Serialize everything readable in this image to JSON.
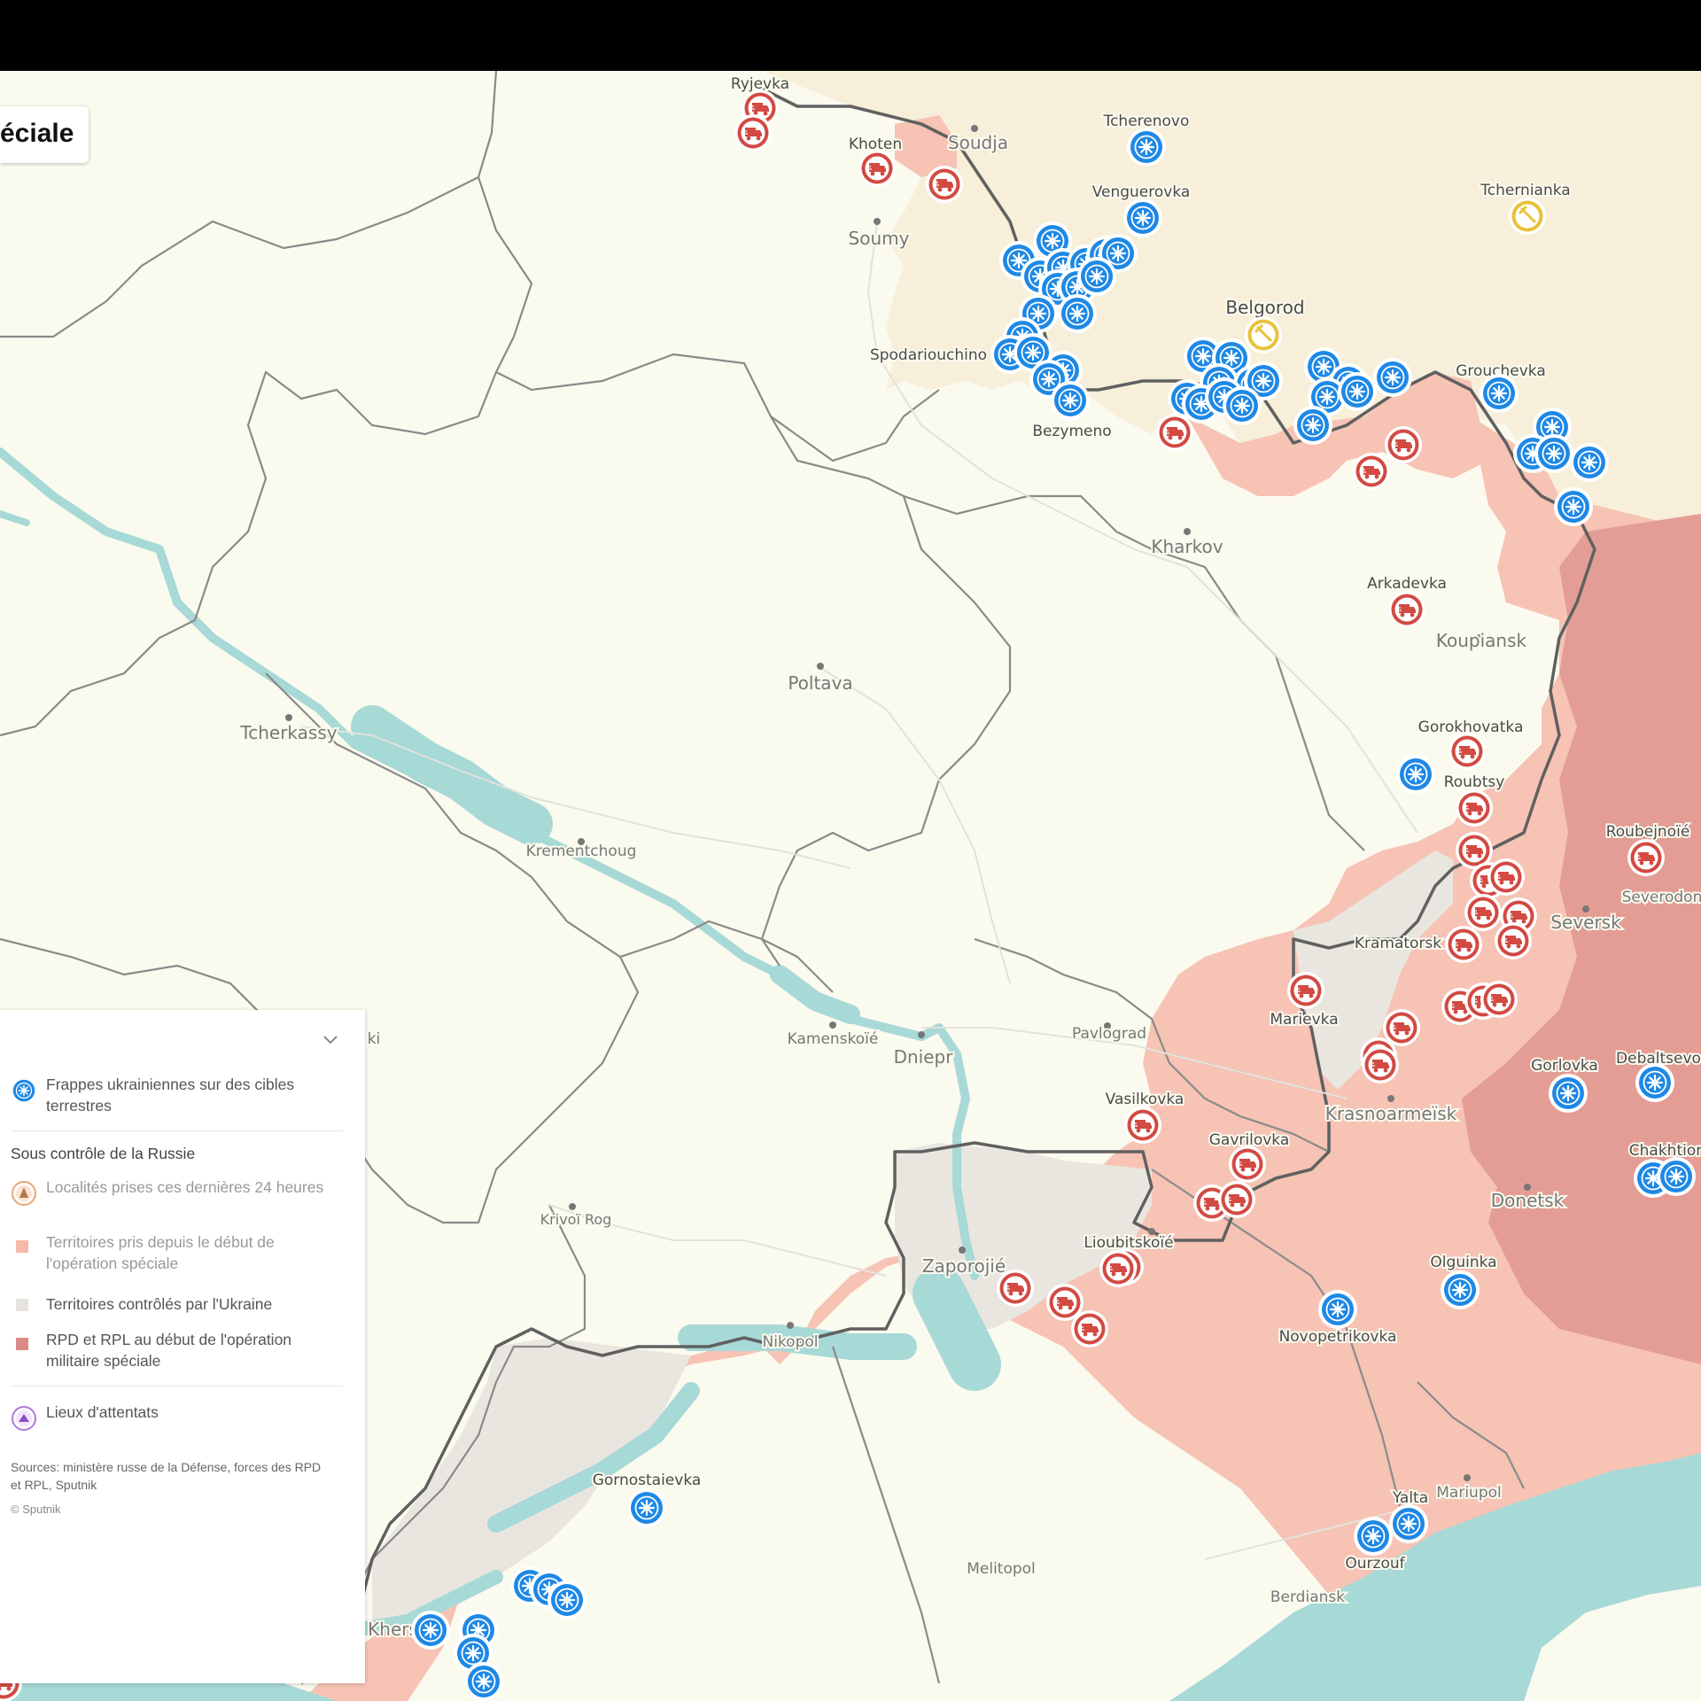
{
  "title": "éciale",
  "colors": {
    "land": "#fbfaef",
    "russia": "#f7efd9",
    "water": "#a7d9d6",
    "occupied": "#f6c3b4",
    "ukraine_controlled": "#e9e6df",
    "dpr_lpr": "#e39d94",
    "strike": "#1e88e5",
    "capture": "#d24a42",
    "attack": "#e8c23a"
  },
  "legend": {
    "strikes_label": "Frappes ukrainiennes sur des cibles terrestres",
    "heading": "Sous contrôle de la Russie",
    "captured_label": "Localités prises ces dernières 24 heures",
    "territories_label": "Territoires pris depuis le début de l'opération spéciale",
    "ukraine_label": "Territoires contrôlés par l'Ukraine",
    "dpr_label": "RPD et RPL au début de l'opération militaire spéciale",
    "attacks_label": "Lieux d'attentats",
    "sources": "Sources: ministère russe de la Défense, forces des RPD et RPL, Sputnik",
    "copyright": "© Sputnik"
  },
  "cities": [
    "Ryjevka",
    "Khoten",
    "Soudja",
    "Soumy",
    "Tcherenovo",
    "Venguerovka",
    "Tchernianka",
    "Belgorod",
    "Spodariouchino",
    "Bezymeno",
    "Grouchevka",
    "Kharkov",
    "Arkadevka",
    "Koupiansk",
    "Poltava",
    "Tcherkassy",
    "Krementchoug",
    "Gorokhovatka",
    "Roubtsy",
    "Roubejnoïé",
    "Severodon",
    "Seversk",
    "Kramatorsk",
    "Marievka",
    "Pavlograd",
    "Kamenskoïé",
    "Dniepr",
    "ki",
    "Gorlovka",
    "Debaltsevo",
    "Krasnoarmeïsk",
    "Vasilkovka",
    "Gavrilovka",
    "Chakhtior",
    "Donetsk",
    "Lioubitskoïé",
    "Zaporojié",
    "Krivoï Rog",
    "Olguinka",
    "Novopetrikovka",
    "Nikopol",
    "Gornostaievka",
    "Mariupol",
    "Yalta",
    "Ourzouf",
    "Melitopol",
    "Berdiansk",
    "Kherson"
  ]
}
